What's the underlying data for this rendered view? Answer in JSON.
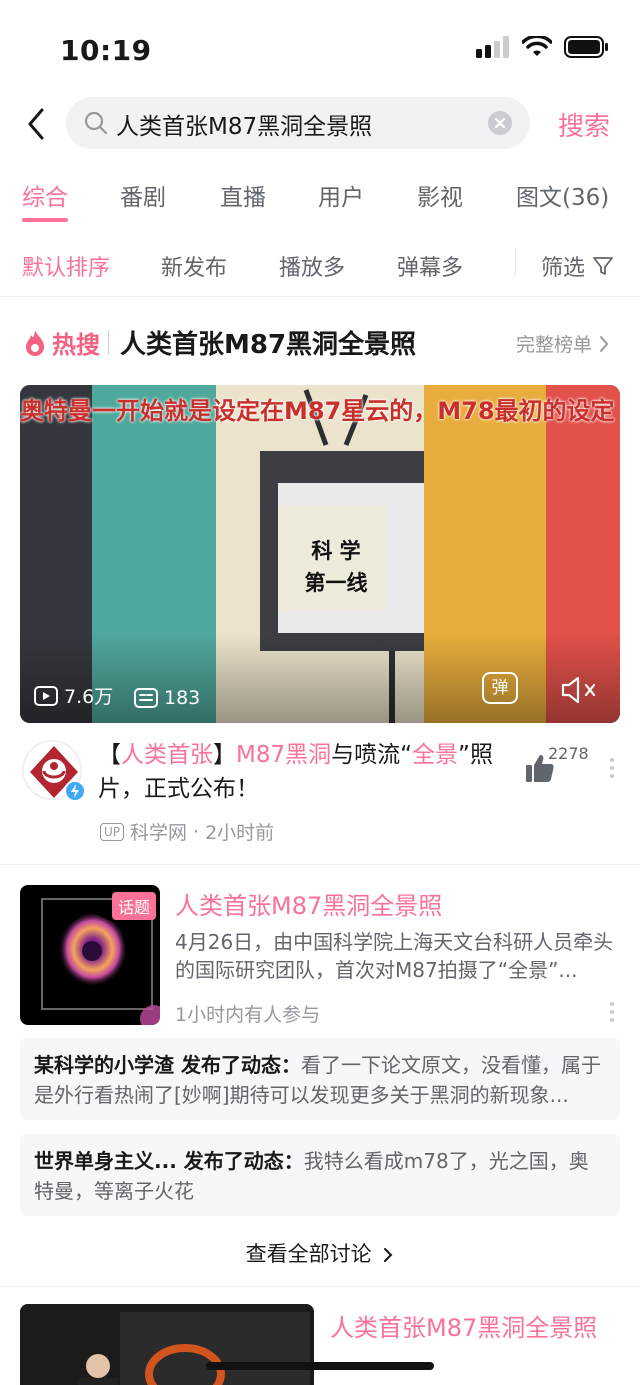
{
  "status_bar": {
    "time": "10:19"
  },
  "search": {
    "query": "人类首张M87黑洞全景照",
    "button": "搜索"
  },
  "tabs": [
    {
      "label": "综合"
    },
    {
      "label": "番剧"
    },
    {
      "label": "直播"
    },
    {
      "label": "用户"
    },
    {
      "label": "影视"
    },
    {
      "label": "图文(36)"
    }
  ],
  "sort": {
    "default": "默认排序",
    "newest": "新发布",
    "most_played": "播放多",
    "most_danmaku": "弹幕多",
    "filter": "筛选"
  },
  "hot_search": {
    "logo_text": "热搜",
    "title": "人类首张M87黑洞全景照",
    "more": "完整榜单"
  },
  "video": {
    "subtitle": "奥特曼一开始就是设定在M87星云的，M78最初的设定",
    "card_text_1": "科 学",
    "card_text_2": "第一线",
    "views": "7.6万",
    "danmaku": "183",
    "danmaku_button": "弹",
    "title_seg1": "【",
    "title_seg2": "人类首张",
    "title_seg3": "】",
    "title_seg4": "M87黑洞",
    "title_seg5": "与喷流“",
    "title_seg6": "全景",
    "title_seg7": "”照片，正式公布！",
    "likes": "2278",
    "up_badge": "UP",
    "uploader": "科学网",
    "time": "2小时前"
  },
  "topic": {
    "badge": "话题",
    "title": "人类首张M87黑洞全景照",
    "description": "4月26日，由中国科学院上海天文台科研人员牵头的国际研究团队，首次对M87拍摄了“全景”...",
    "meta": "1小时内有人参与"
  },
  "comments": [
    {
      "user": "某科学的小学渣",
      "action": " 发布了动态：",
      "text": "看了一下论文原文，没看懂，属于是外行看热闹了[妙啊]期待可以发现更多关于黑洞的新现象..."
    },
    {
      "user": "世界单身主义...",
      "action": " 发布了动态：",
      "text": "我特么看成m78了，光之国，奥特曼，等离子火花"
    }
  ],
  "see_all": "查看全部讨论",
  "bottom_card": {
    "title": "人类首张M87黑洞全景照"
  },
  "colors": {
    "accent": "#fb7299",
    "text": "#18191c",
    "secondary": "#61666d",
    "muted": "#9499a0"
  }
}
